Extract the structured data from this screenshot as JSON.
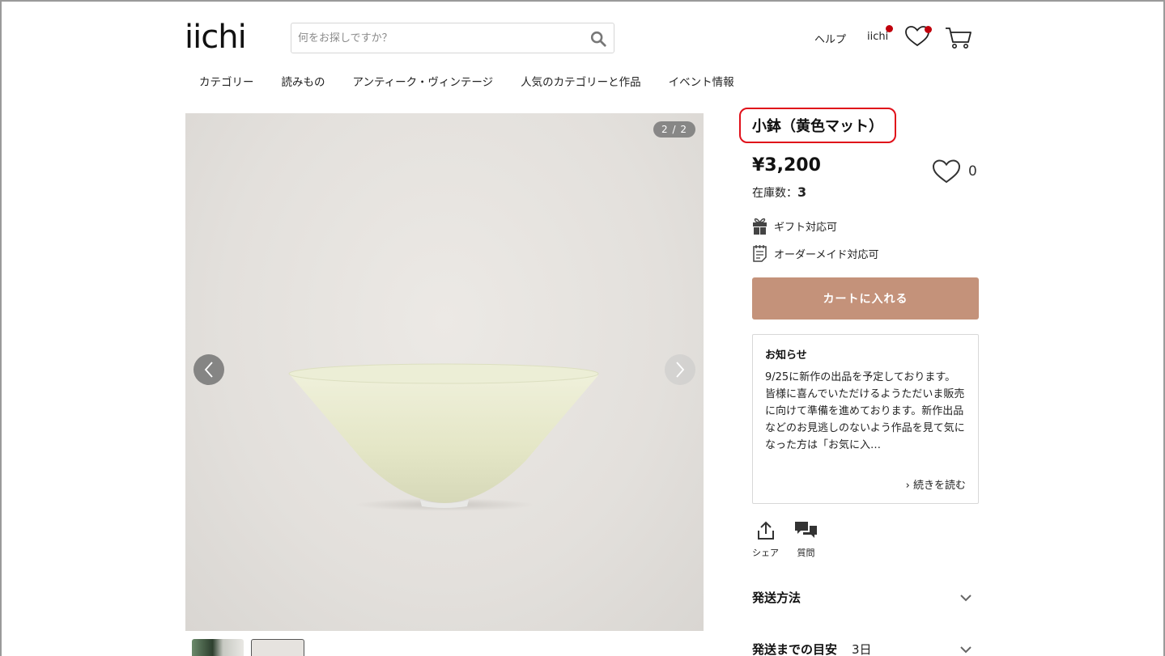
{
  "header": {
    "logo": "iichi",
    "search_placeholder": "何をお探しですか？",
    "help": "ヘルプ",
    "account": "iichi"
  },
  "nav": [
    "カテゴリー",
    "読みもの",
    "アンティーク・ヴィンテージ",
    "人気のカテゴリーと作品",
    "イベント情報"
  ],
  "gallery": {
    "counter": "2 / 2"
  },
  "product": {
    "title": "小鉢（黄色マット）",
    "price": "¥3,200",
    "favorite_count": "0",
    "stock_label": "在庫数：",
    "stock_value": "3",
    "features": [
      "ギフト対応可",
      "オーダーメイド対応可"
    ],
    "cart_button": "カートに入れる"
  },
  "notice": {
    "heading": "お知らせ",
    "body": "9/25に新作の出品を予定しております。皆様に喜んでいただけるようただいま販売に向けて準備を進めております。新作出品などのお見逃しのないよう作品を見て気になった方は「お気に入…",
    "more": "続きを読む"
  },
  "actions": {
    "share": "シェア",
    "question": "質問"
  },
  "accordion": {
    "shipping_method": "発送方法",
    "shipping_eta_label": "発送までの目安",
    "shipping_eta_value": "3日"
  },
  "colors": {
    "accent": "#c4927a",
    "badge_red": "#c0000c",
    "highlight_border": "#e0101a"
  }
}
